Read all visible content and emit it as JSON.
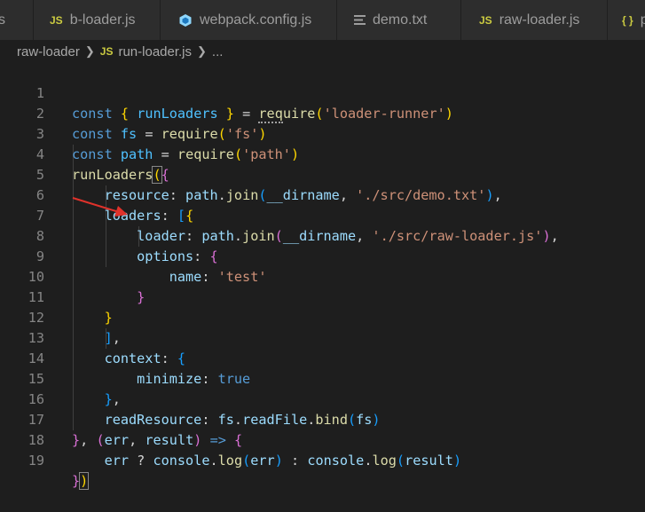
{
  "tabs": [
    {
      "label": "s",
      "icon": "none"
    },
    {
      "label": "b-loader.js",
      "icon": "js-file-icon"
    },
    {
      "label": "webpack.config.js",
      "icon": "webpack-icon"
    },
    {
      "label": "demo.txt",
      "icon": "text-file-icon"
    },
    {
      "label": "raw-loader.js",
      "icon": "js-file-icon"
    },
    {
      "label": "p",
      "icon": "json-file-icon"
    }
  ],
  "breadcrumb": {
    "folder": "raw-loader",
    "file": "run-loader.js",
    "more": "...",
    "js_badge": "JS"
  },
  "tab_badges": {
    "js": "JS",
    "json": "{ }"
  },
  "editor": {
    "line_numbers": [
      "1",
      "2",
      "3",
      "4",
      "5",
      "6",
      "7",
      "8",
      "9",
      "10",
      "11",
      "12",
      "13",
      "14",
      "15",
      "16",
      "17",
      "18",
      "19"
    ]
  },
  "colors": {
    "background": "#1e1e1e",
    "keyword": "#569cd6",
    "variable": "#9cdcfe",
    "function": "#dcdcaa",
    "string": "#ce9178",
    "arrow_annotation": "#e0322b"
  }
}
